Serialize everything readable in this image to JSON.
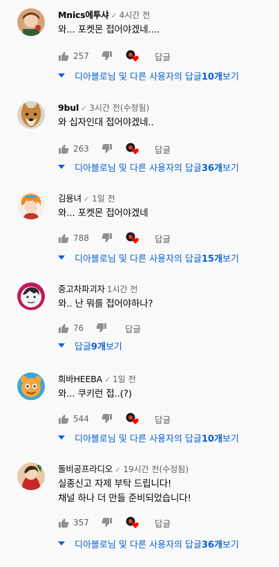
{
  "comments": [
    {
      "author": "Mnics에투샤",
      "time": "4시간 전",
      "lines": [
        "와... 포켓몬 접어야겠네...."
      ],
      "likes": "257",
      "reply_label": "답글",
      "replies_prefix": "디아블로님 및 다른 사용자의 답글 ",
      "replies_count": "10개",
      "replies_suffix": " 보기"
    },
    {
      "author": "9bul",
      "time": "3시간 전(수정됨)",
      "lines": [
        "와 십자인대 접어야겠네.."
      ],
      "likes": "263",
      "reply_label": "답글",
      "replies_prefix": "디아블로님 및 다른 사용자의 답글 ",
      "replies_count": "36개",
      "replies_suffix": " 보기"
    },
    {
      "author": "김용녀",
      "time": "1일 전",
      "lines": [
        "와... 포켓몬 접어야겠네"
      ],
      "likes": "788",
      "reply_label": "답글",
      "replies_prefix": "디아블로님 및 다른 사용자의 답글 ",
      "replies_count": "15개",
      "replies_suffix": " 보기"
    },
    {
      "author": "중고차파괴자",
      "time": "1시간 전",
      "lines": [
        "와.. 난 뭐를 접어야하나?"
      ],
      "likes": "76",
      "reply_label": "답글",
      "replies_prefix": "답글 ",
      "replies_count": "9개",
      "replies_suffix": " 보기"
    },
    {
      "author": "희바HEEBA",
      "time": "1일 전",
      "lines": [
        "와... 쿠키런 접..(?)"
      ],
      "likes": "544",
      "reply_label": "답글",
      "replies_prefix": "디아블로님 및 다른 사용자의 답글 ",
      "replies_count": "10개",
      "replies_suffix": " 보기"
    },
    {
      "author": "돌비공프라디오",
      "time": "19시간 전(수정됨)",
      "lines": [
        "실종신고 자제 부탁 드립니다!",
        "채널 하나 더 만들 준비되었습니다!"
      ],
      "likes": "357",
      "reply_label": "답글",
      "replies_prefix": "디아블로님 및 다른 사용자의 답글 ",
      "replies_count": "36개",
      "replies_suffix": " 보기"
    }
  ],
  "colors": {
    "link": "#065fd4",
    "meta": "#606060",
    "heart": "#ff0000"
  },
  "icons": {
    "like": "thumbs-up-icon",
    "dislike": "thumbs-down-icon",
    "heart": "creator-heart-icon",
    "verified": "check-icon",
    "expand": "caret-down-icon"
  }
}
